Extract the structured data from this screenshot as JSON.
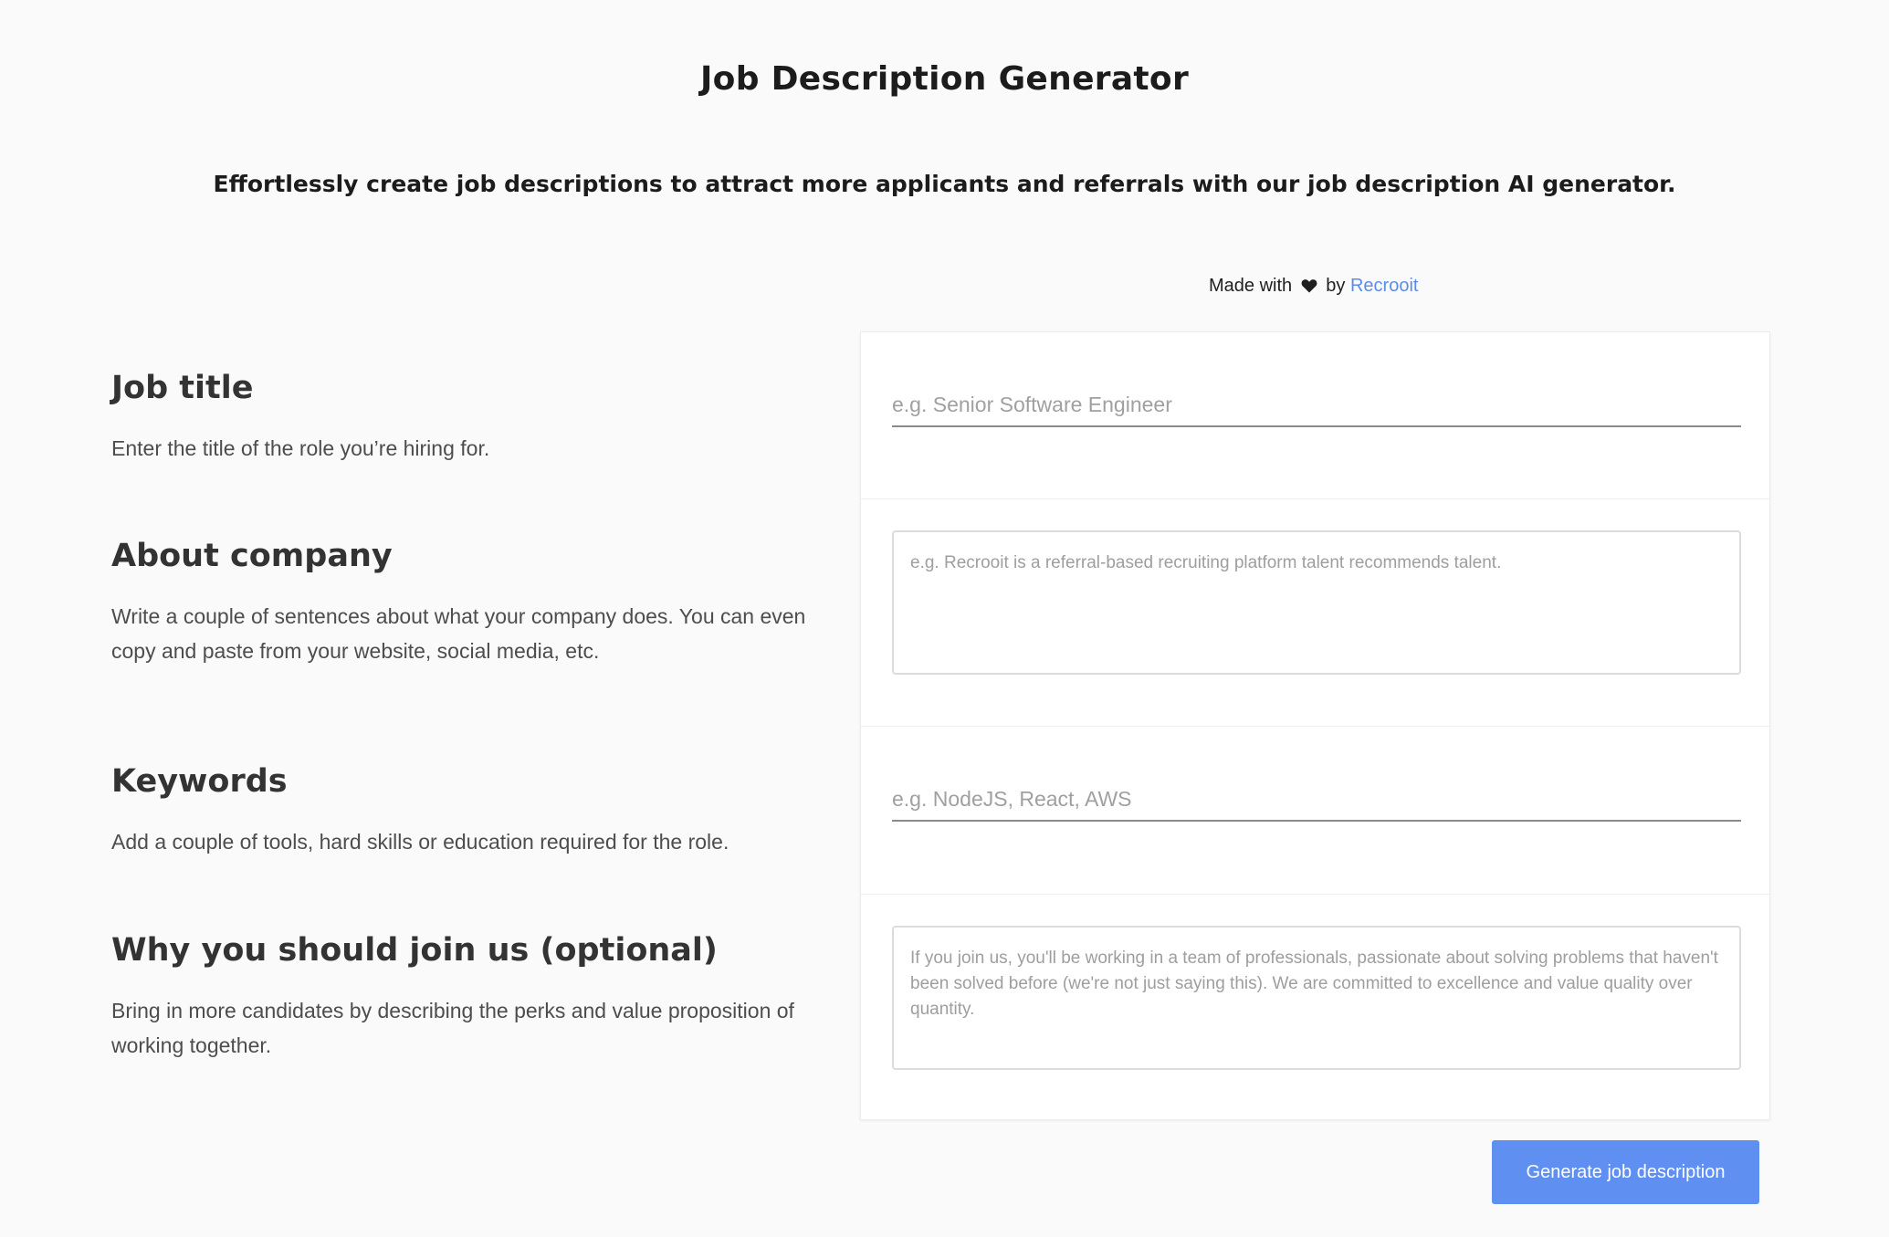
{
  "header": {
    "title": "Job Description Generator",
    "subtitle": "Effortlessly create job descriptions to attract more applicants and referrals with our job description AI generator.",
    "credit_prefix": "Made with",
    "credit_by": "by",
    "credit_link": "Recrooit"
  },
  "sections": {
    "job_title": {
      "heading": "Job title",
      "description": "Enter the title of the role you’re hiring for.",
      "placeholder": "e.g. Senior Software Engineer"
    },
    "about_company": {
      "heading": "About company",
      "description": "Write a couple of sentences about what your company does. You can even copy and paste from your website, social media, etc.",
      "placeholder": "e.g. Recrooit is a referral-based recruiting platform talent recommends talent."
    },
    "keywords": {
      "heading": "Keywords",
      "description": "Add a couple of tools, hard skills or education required for the role.",
      "placeholder": "e.g. NodeJS, React, AWS"
    },
    "why_join": {
      "heading": "Why you should join us (optional)",
      "description": "Bring in more candidates by describing the perks and value proposition of working together.",
      "placeholder": "If you join us, you'll be working in a team of professionals, passionate about solving problems that haven't been solved before (we're not just saying this). We are committed to excellence and value quality over quantity."
    }
  },
  "actions": {
    "generate_label": "Generate job description"
  },
  "colors": {
    "accent": "#5f8ff0",
    "link": "#5b8ce6",
    "background": "#fafafa"
  }
}
